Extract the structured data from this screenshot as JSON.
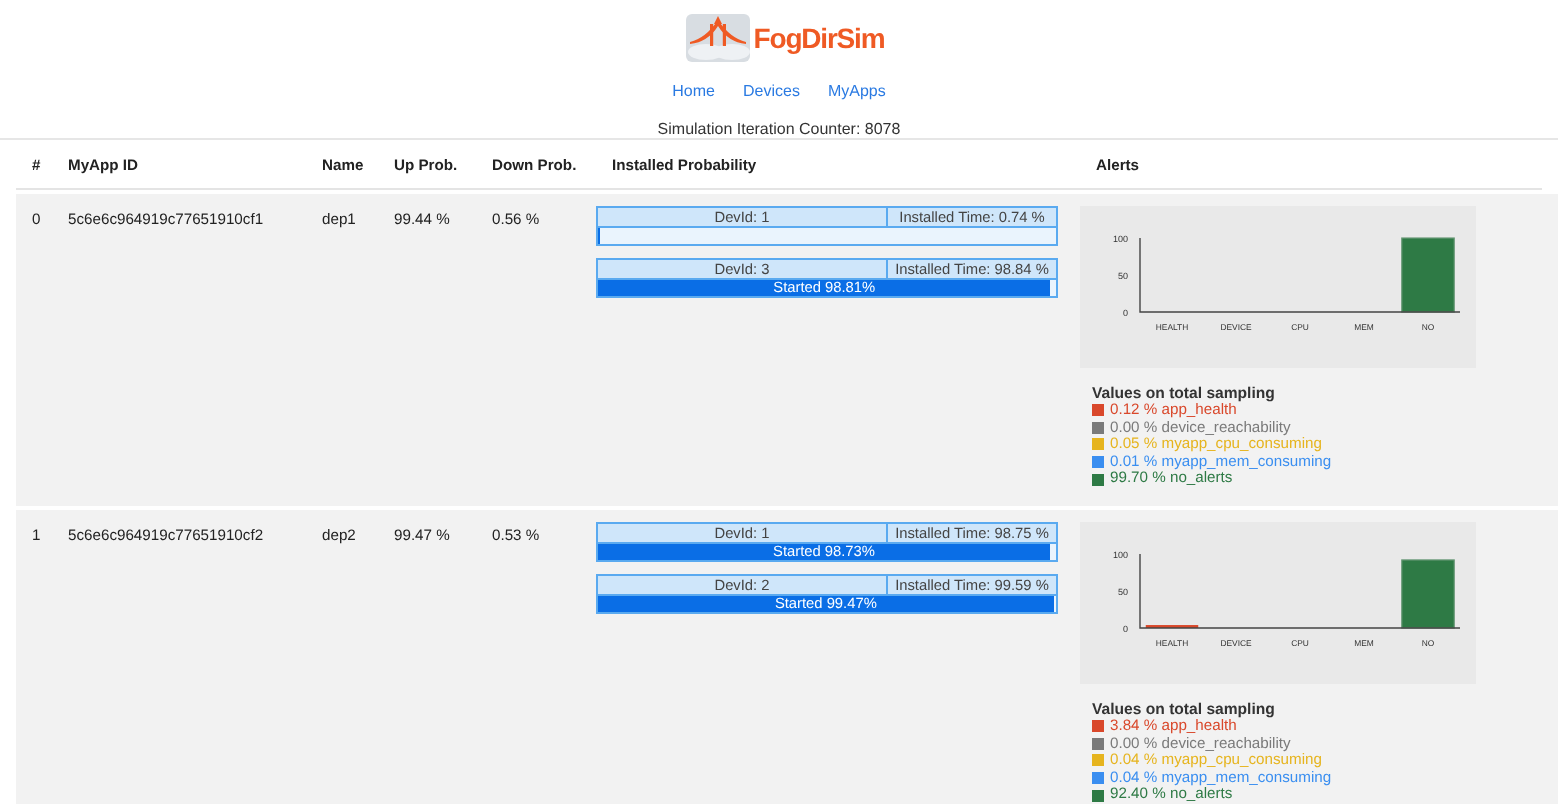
{
  "logo": {
    "text": "FogDirSim"
  },
  "nav": [
    {
      "label": "Home"
    },
    {
      "label": "Devices"
    },
    {
      "label": "MyApps"
    }
  ],
  "counter": "Simulation Iteration Counter: 8078",
  "table": {
    "columns": [
      "#",
      "MyApp ID",
      "Name",
      "Up Prob.",
      "Down Prob.",
      "Installed Probability",
      "Alerts"
    ],
    "rows": [
      {
        "index": "0",
        "id": "5c6e6c964919c77651910cf1",
        "name": "dep1",
        "up": "99.44 %",
        "down": "0.56 %",
        "deployments": [
          {
            "devid": "DevId: 1",
            "installed": "Installed Time: 0.74 %",
            "level": 0.005
          },
          {
            "devid": "DevId: 3",
            "installed": "Installed Time: 98.84 %",
            "level": 0.988,
            "progress_label": "Started 98.81%"
          }
        ],
        "alerts": {
          "chart_data": {
            "type": "bar",
            "categories": [
              "HEALTH",
              "DEVICE",
              "CPU",
              "MEM",
              "NO"
            ],
            "values": [
              0,
              0,
              0,
              0,
              100
            ],
            "ylim": [
              0,
              100
            ],
            "yticks": [
              0,
              50,
              100
            ]
          },
          "legend_title": "Values on total sampling",
          "legend": [
            {
              "text": "0.12 % app_health",
              "color": "#d9482b"
            },
            {
              "text": "0.00 % device_reachability",
              "color": "#7a7a7a"
            },
            {
              "text": "0.05 % myapp_cpu_consuming",
              "color": "#e6b41e"
            },
            {
              "text": "0.01 % myapp_mem_consuming",
              "color": "#3a8ef0"
            },
            {
              "text": "99.70 % no_alerts",
              "color": "#2e7a45"
            }
          ]
        }
      },
      {
        "index": "1",
        "id": "5c6e6c964919c77651910cf2",
        "name": "dep2",
        "up": "99.47 %",
        "down": "0.53 %",
        "deployments": [
          {
            "devid": "DevId: 1",
            "installed": "Installed Time: 98.75 %",
            "level": 0.987,
            "progress_label": "Started 98.73%"
          },
          {
            "devid": "DevId: 2",
            "installed": "Installed Time: 99.59 %",
            "level": 0.995,
            "progress_label": "Started 99.47%"
          }
        ],
        "alerts": {
          "chart_data": {
            "type": "bar",
            "categories": [
              "HEALTH",
              "DEVICE",
              "CPU",
              "MEM",
              "NO"
            ],
            "values": [
              4,
              0,
              0,
              0,
              92
            ],
            "ylim": [
              0,
              100
            ],
            "yticks": [
              0,
              50,
              100
            ]
          },
          "legend_title": "Values on total sampling",
          "legend": [
            {
              "text": "3.84 % app_health",
              "color": "#d9482b"
            },
            {
              "text": "0.00 % device_reachability",
              "color": "#7a7a7a"
            },
            {
              "text": "0.04 % myapp_cpu_consuming",
              "color": "#e6b41e"
            },
            {
              "text": "0.04 % myapp_mem_consuming",
              "color": "#3a8ef0"
            },
            {
              "text": "92.40 % no_alerts",
              "color": "#2e7a45"
            }
          ]
        }
      }
    ]
  }
}
